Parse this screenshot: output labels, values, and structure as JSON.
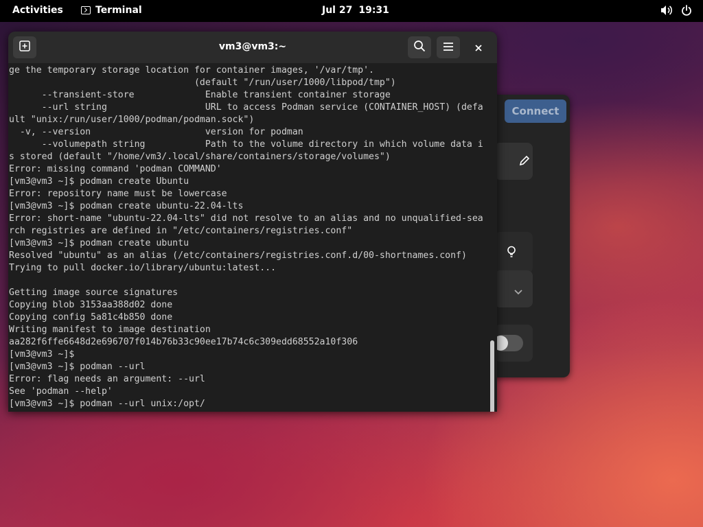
{
  "topbar": {
    "activities": "Activities",
    "app_name": "Terminal",
    "date": "Jul 27",
    "time": "19:31",
    "icons": [
      "terminal-icon",
      "volume-icon",
      "power-icon"
    ]
  },
  "background_window": {
    "connect_label": "Connect",
    "icons": [
      "pencil-icon",
      "lightbulb-icon",
      "chevron-down-icon"
    ],
    "toggle": "off"
  },
  "terminal": {
    "title": "vm3@vm3:~",
    "icons": [
      "new-tab-icon",
      "search-icon",
      "menu-icon",
      "close-icon"
    ],
    "lines": [
      "ge the temporary storage location for container images, '/var/tmp'.",
      "                                  (default \"/run/user/1000/libpod/tmp\")",
      "      --transient-store             Enable transient container storage",
      "      --url string                  URL to access Podman service (CONTAINER_HOST) (defa",
      "ult \"unix:/run/user/1000/podman/podman.sock\")",
      "  -v, --version                     version for podman",
      "      --volumepath string           Path to the volume directory in which volume data i",
      "s stored (default \"/home/vm3/.local/share/containers/storage/volumes\")",
      "Error: missing command 'podman COMMAND'",
      "[vm3@vm3 ~]$ podman create Ubuntu",
      "Error: repository name must be lowercase",
      "[vm3@vm3 ~]$ podman create ubuntu-22.04-lts",
      "Error: short-name \"ubuntu-22.04-lts\" did not resolve to an alias and no unqualified-sea",
      "rch registries are defined in \"/etc/containers/registries.conf\"",
      "[vm3@vm3 ~]$ podman create ubuntu",
      "Resolved \"ubuntu\" as an alias (/etc/containers/registries.conf.d/00-shortnames.conf)",
      "Trying to pull docker.io/library/ubuntu:latest...",
      "",
      "Getting image source signatures",
      "Copying blob 3153aa388d02 done",
      "Copying config 5a81c4b850 done",
      "Writing manifest to image destination",
      "aa282f6ffe6648d2e696707f014b76b33c90ee17b74c6c309edd68552a10f306",
      "[vm3@vm3 ~]$",
      "[vm3@vm3 ~]$ podman --url",
      "Error: flag needs an argument: --url",
      "See 'podman --help'",
      "[vm3@vm3 ~]$ podman --url unix:/opt/"
    ]
  }
}
